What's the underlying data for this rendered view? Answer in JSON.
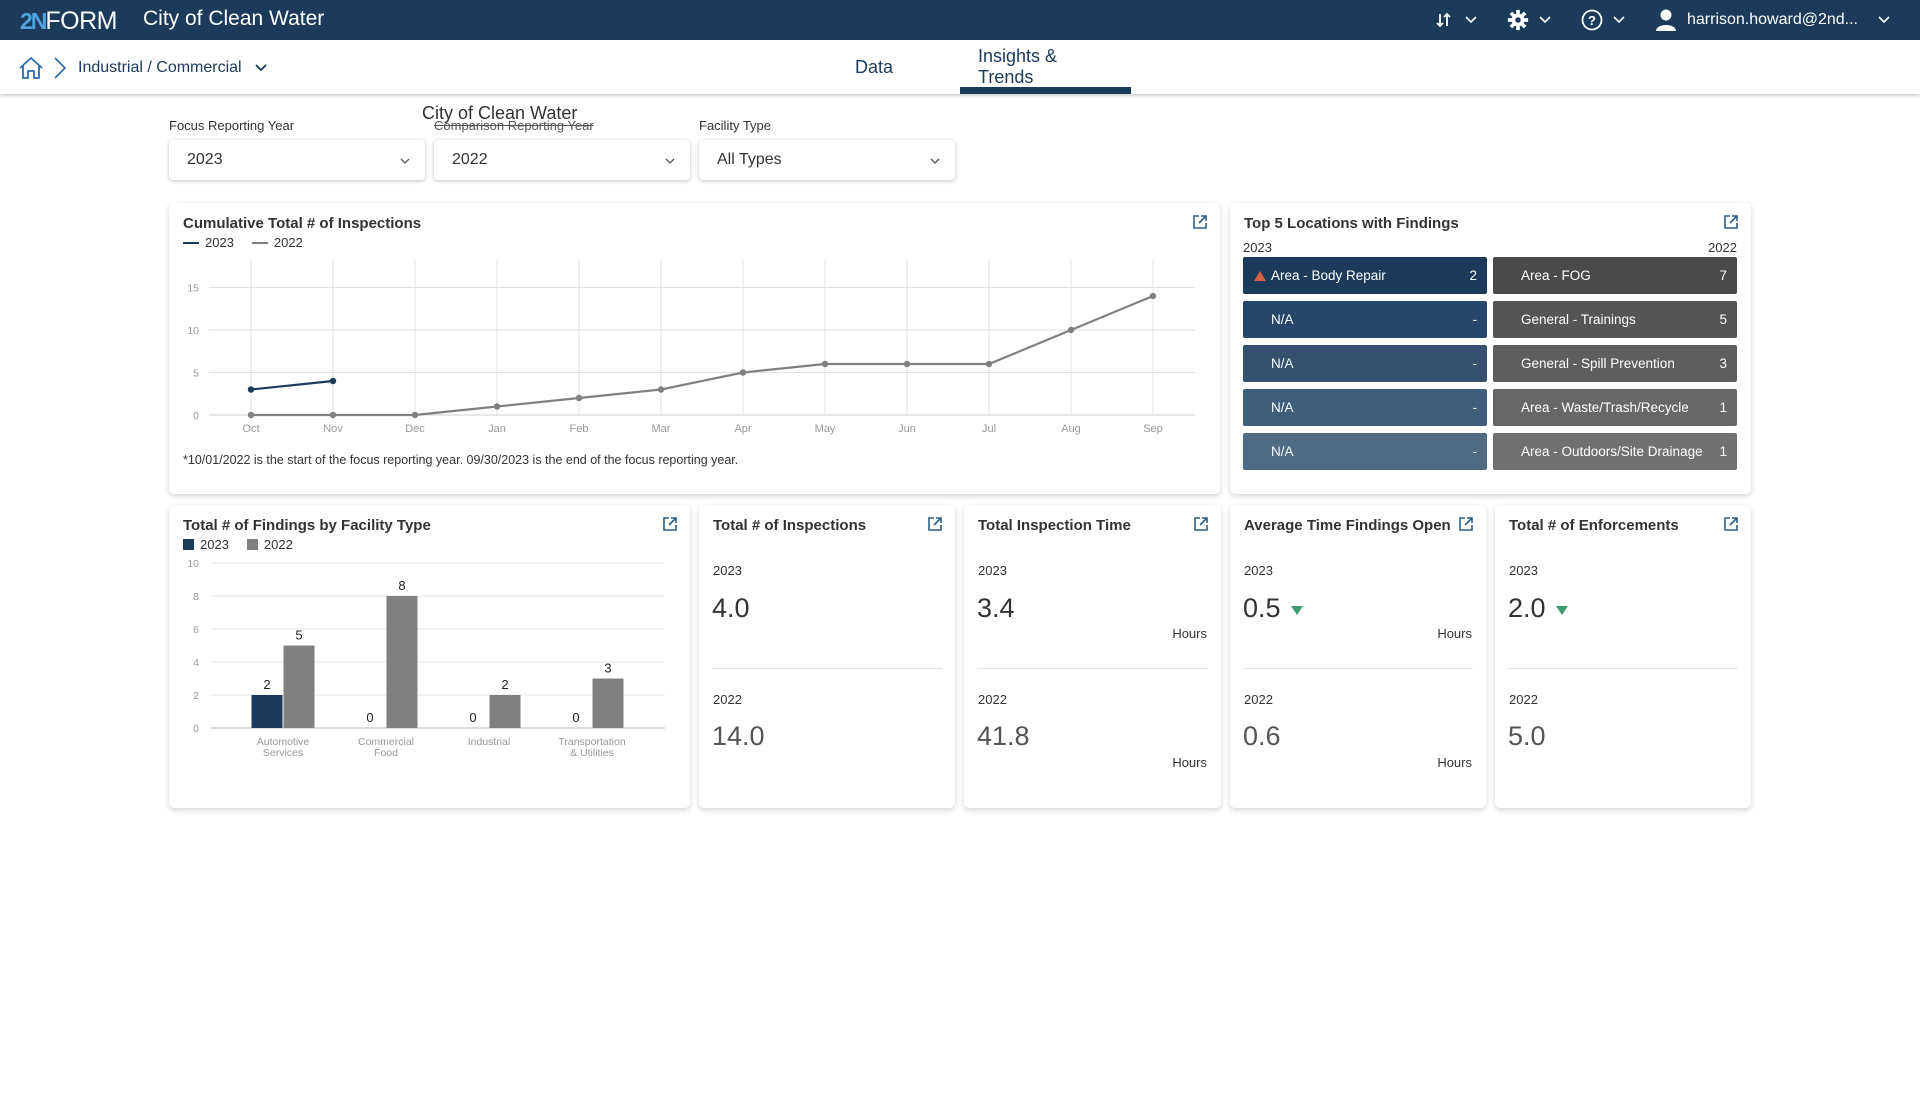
{
  "header": {
    "logo_mark": "2N",
    "logo_text": "FORM",
    "app_title": "City of Clean Water",
    "icons": [
      "sort-icon",
      "gear-icon",
      "help-icon",
      "user-icon"
    ],
    "user": "harrison.howard@2nd..."
  },
  "nav": {
    "breadcrumb": "Industrial / Commercial",
    "tabs": [
      {
        "label": "Data",
        "active": false
      },
      {
        "label": "Insights & Trends",
        "active": true
      }
    ]
  },
  "filters": {
    "floating_title": "City of Clean Water",
    "focus": {
      "label": "Focus Reporting Year",
      "value": "2023"
    },
    "comparison": {
      "label": "Comparison Reporting Year",
      "value": "2022"
    },
    "facility": {
      "label": "Facility Type",
      "value": "All Types"
    }
  },
  "cumulative": {
    "title": "Cumulative Total # of Inspections",
    "note": "*10/01/2022 is the start of the focus reporting year. 09/30/2023 is the end of the focus reporting year."
  },
  "top5": {
    "title": "Top 5 Locations with Findings",
    "year_focus": "2023",
    "year_comparison": "2022",
    "focus": [
      {
        "name": "Area - Body Repair",
        "value": "2",
        "trend": "up"
      },
      {
        "name": "N/A",
        "value": "-"
      },
      {
        "name": "N/A",
        "value": "-"
      },
      {
        "name": "N/A",
        "value": "-"
      },
      {
        "name": "N/A",
        "value": "-"
      }
    ],
    "comparison": [
      {
        "name": "Area - FOG",
        "value": "7"
      },
      {
        "name": "General - Trainings",
        "value": "5"
      },
      {
        "name": "General - Spill Prevention",
        "value": "3"
      },
      {
        "name": "Area - Waste/Trash/Recycle",
        "value": "1"
      },
      {
        "name": "Area - Outdoors/Site Drainage",
        "value": "1"
      }
    ],
    "focus_colors": [
      "#1c3a5c",
      "#26466b",
      "#34526f",
      "#3f5e7b",
      "#4e6a85"
    ],
    "comparison_colors": [
      "#4a4a4a",
      "#555555",
      "#5e5e5e",
      "#676767",
      "#717171"
    ]
  },
  "findings": {
    "title": "Total # of Findings by Facility Type"
  },
  "kpis": [
    {
      "title": "Total # of Inspections",
      "year_focus": "2023",
      "value_focus": "4.0",
      "unit_focus": "",
      "trend": "",
      "year_comparison": "2022",
      "value_comparison": "14.0",
      "unit_comparison": ""
    },
    {
      "title": "Total Inspection Time",
      "year_focus": "2023",
      "value_focus": "3.4",
      "unit_focus": "Hours",
      "trend": "",
      "year_comparison": "2022",
      "value_comparison": "41.8",
      "unit_comparison": "Hours"
    },
    {
      "title": "Average Time Findings Open",
      "year_focus": "2023",
      "value_focus": "0.5",
      "unit_focus": "Hours",
      "trend": "down",
      "year_comparison": "2022",
      "value_comparison": "0.6",
      "unit_comparison": "Hours"
    },
    {
      "title": "Total # of Enforcements",
      "year_focus": "2023",
      "value_focus": "2.0",
      "unit_focus": "",
      "trend": "down",
      "year_comparison": "2022",
      "value_comparison": "5.0",
      "unit_comparison": ""
    }
  ],
  "colors": {
    "brand_navy": "#1c3a5c",
    "series_2022": "#808080",
    "trend_up": "#d85f48",
    "trend_down": "#3f9a72",
    "logo_accent": "#4fa3e0"
  },
  "chart_data": [
    {
      "type": "line",
      "title": "Cumulative Total # of Inspections",
      "x": [
        "Oct",
        "Nov",
        "Dec",
        "Jan",
        "Feb",
        "Mar",
        "Apr",
        "May",
        "Jun",
        "Jul",
        "Aug",
        "Sep"
      ],
      "series": [
        {
          "name": "2023",
          "color": "#1c3a5c",
          "values": [
            3,
            4,
            null,
            null,
            null,
            null,
            null,
            null,
            null,
            null,
            null,
            null
          ]
        },
        {
          "name": "2022",
          "color": "#808080",
          "values": [
            0,
            0,
            0,
            1,
            2,
            3,
            5,
            6,
            6,
            6,
            10,
            14
          ]
        }
      ],
      "yticks": [
        0,
        5,
        10,
        15
      ],
      "ylim": [
        0,
        18
      ],
      "grid": true,
      "legend": "top-left",
      "xlabel": "",
      "ylabel": ""
    },
    {
      "type": "bar",
      "title": "Total # of Findings by Facility Type",
      "categories": [
        "Automotive Services",
        "Commercial Food",
        "Industrial",
        "Transportation & Utilities"
      ],
      "category_lines": [
        [
          "Automotive",
          "Services"
        ],
        [
          "Commercial",
          "Food"
        ],
        [
          "Industrial"
        ],
        [
          "Transportation",
          "& Utilities"
        ]
      ],
      "series": [
        {
          "name": "2023",
          "color": "#1c3a5c",
          "values": [
            2,
            0,
            0,
            0
          ]
        },
        {
          "name": "2022",
          "color": "#808080",
          "values": [
            5,
            8,
            2,
            3
          ]
        }
      ],
      "yticks": [
        0,
        2,
        4,
        6,
        8,
        10
      ],
      "ylim": [
        0,
        10
      ],
      "grid": true,
      "legend": "top-left",
      "xlabel": "",
      "ylabel": ""
    }
  ]
}
